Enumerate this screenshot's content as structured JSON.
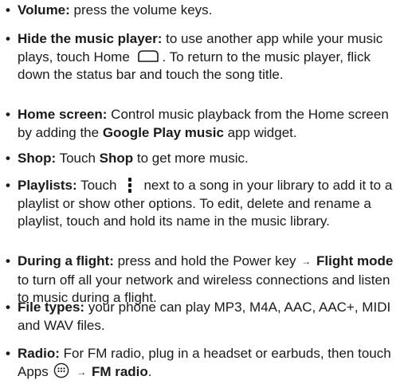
{
  "tips": {
    "volume": {
      "term": "Volume:",
      "text": " press the volume keys."
    },
    "hide": {
      "term": "Hide the music player:",
      "text_before_icon": " to use another app while your music plays, touch Home",
      "text_after_icon": ". To return to the music player, flick down the status bar and touch the song title.",
      "icon": "home-icon"
    },
    "home_screen": {
      "term": "Home screen:",
      "text_before_bold": " Control music playback from the Home screen by adding the ",
      "bold": "Google Play music",
      "text_after_bold": " app widget."
    },
    "shop": {
      "term": "Shop:",
      "text_before_bold": " Touch ",
      "bold": "Shop",
      "text_after_bold": " to get more music."
    },
    "playlists": {
      "term": "Playlists:",
      "text_before_icon": " Touch",
      "icon": "menu-icon",
      "text_after_icon": "next to a song in your library to add it to a playlist or show other options. To edit, delete and rename a playlist, touch and hold its name in the music library."
    },
    "flight": {
      "term": "During a flight:",
      "text_before_arrow": " press and hold the Power key",
      "arrow": "→",
      "bold": "Flight mode",
      "text_after_bold": " to turn off all your network and wireless connections and listen to music during a flight."
    },
    "file_types": {
      "term": "File types:",
      "text": " your phone can play MP3, M4A, AAC, AAC+, MIDI and WAV files."
    },
    "radio": {
      "term": "Radio:",
      "text_before_icon": " For FM radio, plug in a headset or earbuds, then touch Apps",
      "icon": "apps-icon",
      "arrow": "→",
      "bold": "FM radio",
      "text_after_bold": "."
    }
  },
  "bullet": "•"
}
